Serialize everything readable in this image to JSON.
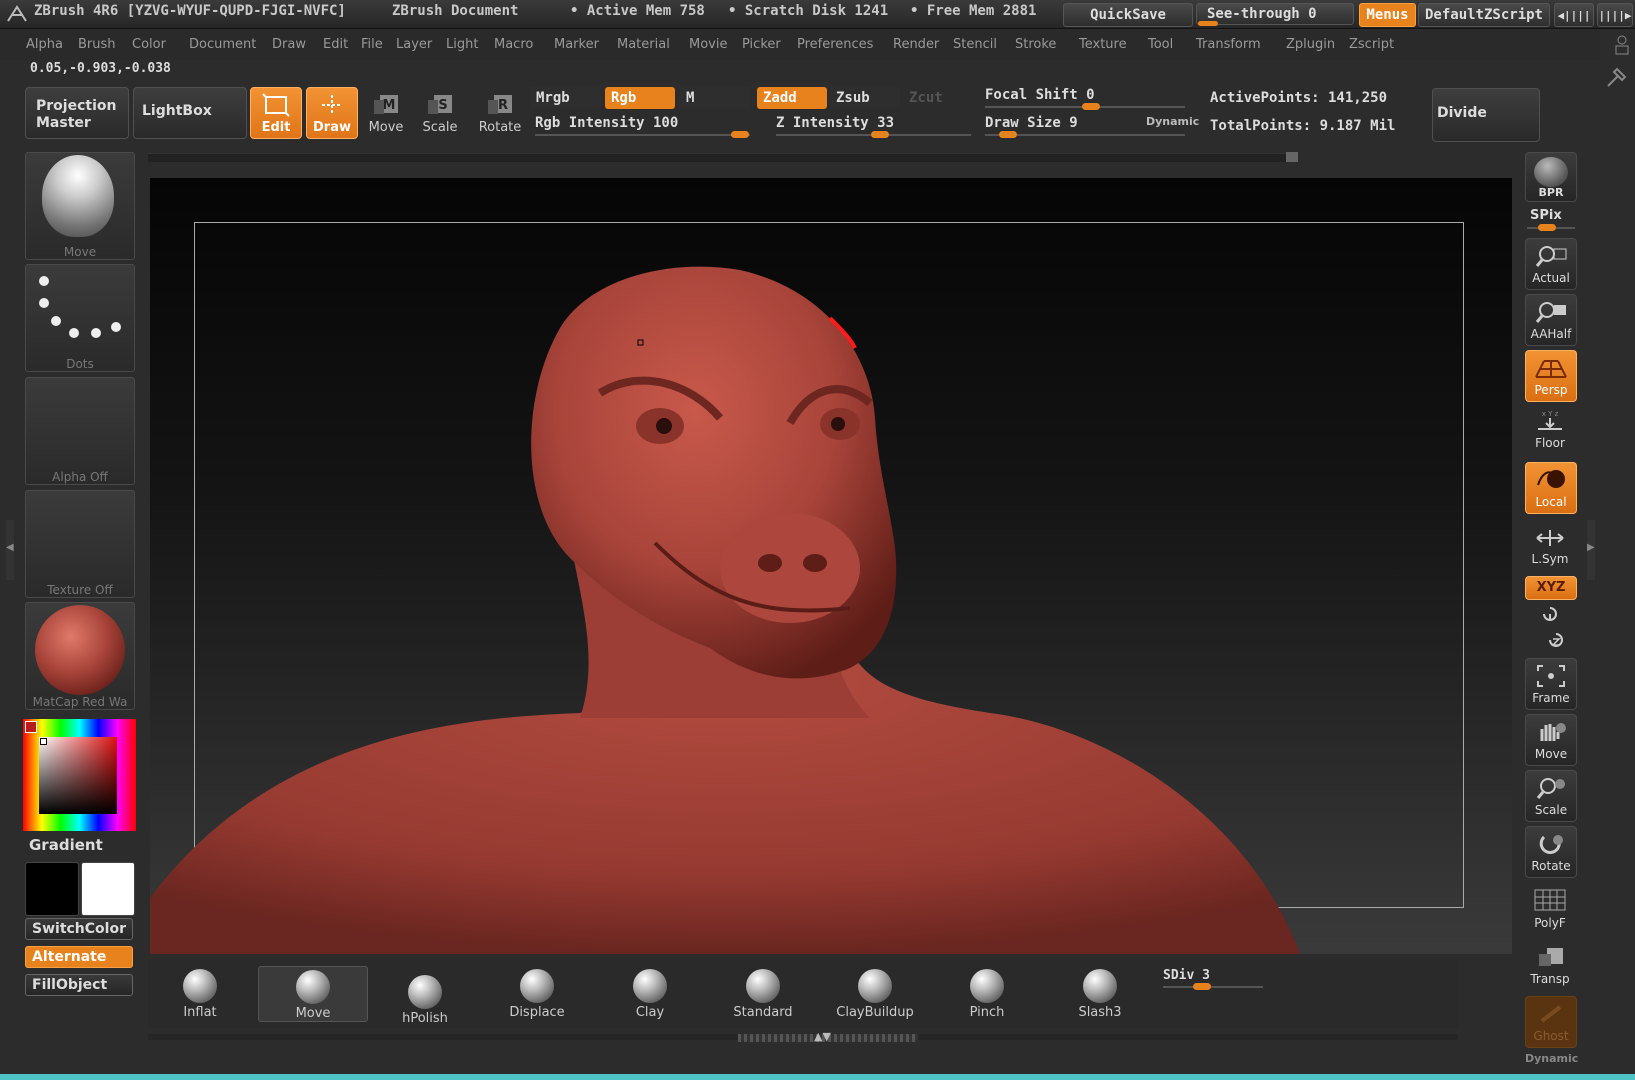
{
  "app": {
    "title": "ZBrush 4R6 [YZVG-WYUF-QUPD-FJGI-NVFC]",
    "document": "ZBrush Document",
    "active_mem": "• Active Mem 758",
    "scratch_disk": "• Scratch Disk 1241",
    "free_mem": "• Free Mem 2881",
    "quicksave": "QuickSave",
    "see_through": "See-through  0",
    "menus": "Menus",
    "default_zscript": "DefaultZScript"
  },
  "menu": [
    "Alpha",
    "Brush",
    "Color",
    "Document",
    "Draw",
    "Edit",
    "File",
    "Layer",
    "Light",
    "Macro",
    "Marker",
    "Material",
    "Movie",
    "Picker",
    "Preferences",
    "Render",
    "Stencil",
    "Stroke",
    "Texture",
    "Tool",
    "Transform",
    "Zplugin",
    "Zscript"
  ],
  "coords": "0.05,-0.903,-0.038",
  "toolbar": {
    "projection_master": "Projection Master",
    "lightbox": "LightBox",
    "edit": "Edit",
    "draw": "Draw",
    "move": "Move",
    "scale": "Scale",
    "rotate": "Rotate",
    "mrgb": "Mrgb",
    "rgb": "Rgb",
    "m": "M",
    "zadd": "Zadd",
    "zsub": "Zsub",
    "zcut": "Zcut",
    "rgb_intensity": "Rgb Intensity 100",
    "z_intensity": "Z Intensity 33",
    "focal_shift": "Focal Shift 0",
    "draw_size": "Draw Size 9",
    "dynamic": "Dynamic",
    "active_points": "ActivePoints: 141,250",
    "total_points": "TotalPoints: 9.187 Mil",
    "divide": "Divide"
  },
  "left": {
    "brush_cap": "Move",
    "stroke_cap": "Dots",
    "alpha_cap": "Alpha Off",
    "texture_cap": "Texture Off",
    "material_cap": "MatCap Red Wa",
    "gradient": "Gradient",
    "switch_color": "SwitchColor",
    "alternate": "Alternate",
    "fill_object": "FillObject"
  },
  "right": {
    "bpr": "BPR",
    "spix": "SPix",
    "actual": "Actual",
    "aahalf": "AAHalf",
    "persp": "Persp",
    "floor": "Floor",
    "local": "Local",
    "lsym": "L.Sym",
    "xyz": "XYZ",
    "frame": "Frame",
    "move": "Move",
    "scale": "Scale",
    "rotate": "Rotate",
    "polyf": "PolyF",
    "transp": "Transp",
    "ghost": "Ghost",
    "dynamic": "Dynamic"
  },
  "brushes": [
    "Inflat",
    "Move",
    "hPolish",
    "Displace",
    "Clay",
    "Standard",
    "ClayBuildup",
    "Pinch",
    "Slash3"
  ],
  "sdiv": "SDiv 3",
  "colors": {
    "accent": "#e8821c",
    "model": "#a8443a"
  }
}
